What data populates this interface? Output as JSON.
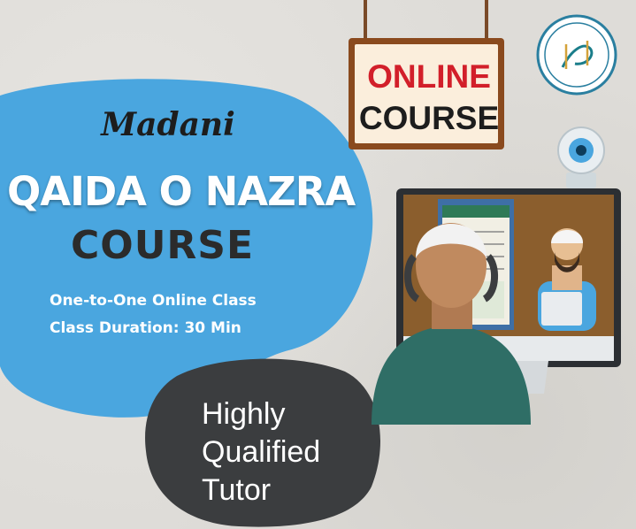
{
  "sign": {
    "line1": "ONLINE",
    "line2": "COURSE"
  },
  "logo": {
    "text": "الرزاق",
    "icon": "brand-logo-icon"
  },
  "headline": {
    "script_word": "Madani",
    "title_line1": "QAIDA O NAZRA",
    "title_line2": "COURSE"
  },
  "info": {
    "line1": "One-to-One Online Class",
    "line2": "Class Duration: 30 Min"
  },
  "tutor_badge": {
    "line1": "Highly",
    "line2": "Qualified",
    "line3": "Tutor"
  },
  "colors": {
    "blue_blob": "#4aa6df",
    "dark_blob": "#3b3d3f",
    "sign_red": "#d21f2a",
    "sign_frame": "#8a4a1e",
    "monitor": "#2c2f33",
    "student_shirt": "#2f6e66"
  },
  "illustration": {
    "icons": [
      "webcam-icon",
      "monitor-icon",
      "student-figure",
      "teacher-figure",
      "book-icon"
    ]
  }
}
